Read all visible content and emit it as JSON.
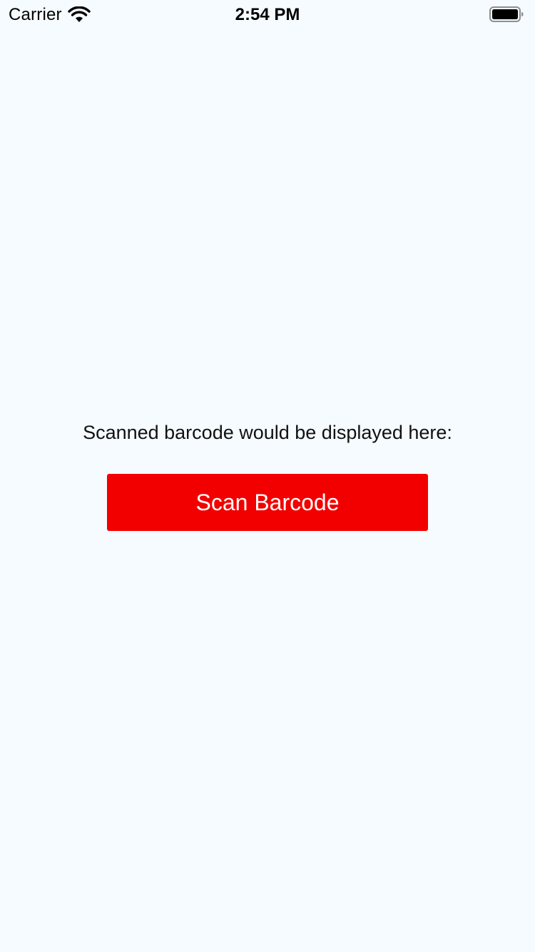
{
  "status_bar": {
    "carrier": "Carrier",
    "time": "2:54 PM",
    "wifi_icon": "wifi-icon",
    "battery_icon": "battery-icon"
  },
  "main": {
    "barcode_label": "Scanned barcode would be displayed here:",
    "scan_button_label": "Scan Barcode"
  },
  "colors": {
    "background": "#f5fbff",
    "button": "#f20000",
    "button_text": "#ffffff"
  }
}
